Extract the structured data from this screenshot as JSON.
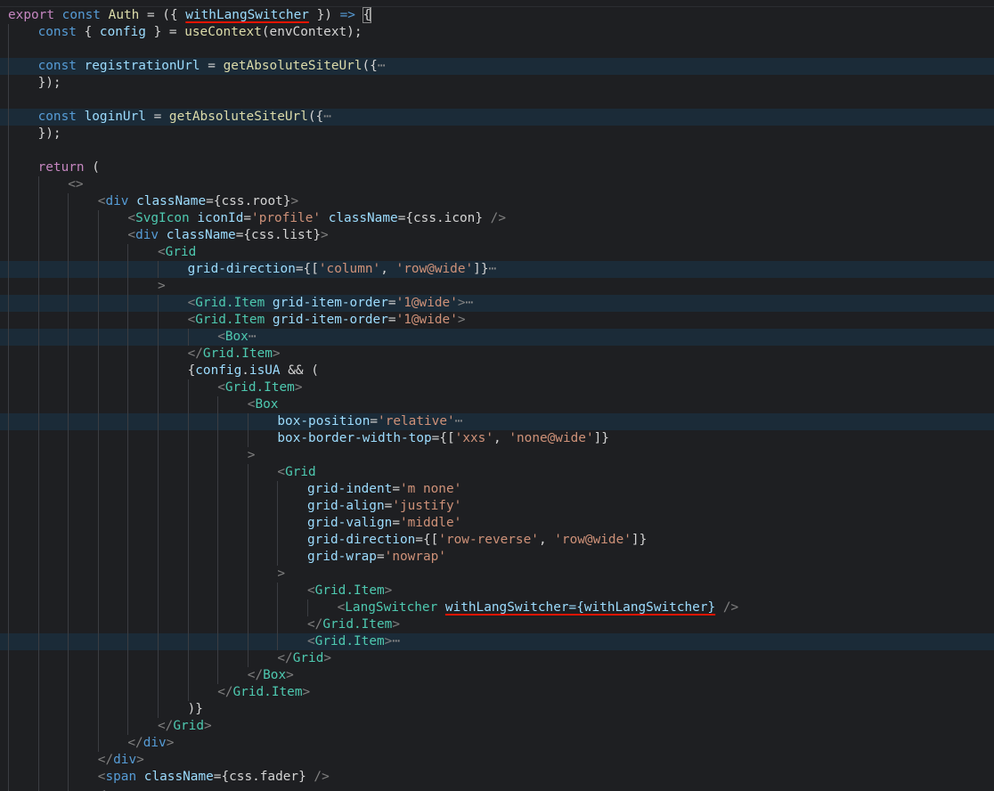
{
  "editor": {
    "language": "tsx",
    "theme_colors": {
      "background": "#1e1f22",
      "line_highlight": "#1b2b38",
      "indent_guide": "#3b3d42",
      "keyword": "#c586c0",
      "storage": "#569cd6",
      "tag": "#4ec9b0",
      "attribute": "#9cdcfe",
      "function": "#dcdcaa",
      "string": "#ce9178",
      "punctuation": "#808080",
      "error_underline": "#e51400"
    },
    "lines": [
      {
        "indent": 0,
        "hl": false,
        "tokens": [
          [
            "export",
            "kw"
          ],
          [
            " ",
            "pl"
          ],
          [
            "const",
            "st"
          ],
          [
            " ",
            "pl"
          ],
          [
            "Auth",
            "ty"
          ],
          [
            " = ({ ",
            "pl"
          ],
          [
            "withLangSwitcher",
            "id err"
          ],
          [
            " }) ",
            "pl"
          ],
          [
            "=>",
            "st"
          ],
          [
            " ",
            "pl"
          ],
          [
            "{",
            "pl mbr"
          ]
        ]
      },
      {
        "indent": 1,
        "hl": false,
        "tokens": [
          [
            "const",
            "st"
          ],
          [
            " { ",
            "pl"
          ],
          [
            "config",
            "id"
          ],
          [
            " } = ",
            "pl"
          ],
          [
            "useContext",
            "fn"
          ],
          [
            "(envContext);",
            "pl"
          ]
        ]
      },
      {
        "indent": 1,
        "hl": false,
        "tokens": []
      },
      {
        "indent": 1,
        "hl": true,
        "tokens": [
          [
            "const",
            "st"
          ],
          [
            " ",
            "pl"
          ],
          [
            "registrationUrl",
            "id"
          ],
          [
            " = ",
            "pl"
          ],
          [
            "getAbsoluteSiteUrl",
            "fn"
          ],
          [
            "({",
            "pl"
          ],
          [
            "⋯",
            "ell"
          ]
        ]
      },
      {
        "indent": 1,
        "hl": false,
        "tokens": [
          [
            "});",
            "pl"
          ]
        ]
      },
      {
        "indent": 1,
        "hl": false,
        "tokens": []
      },
      {
        "indent": 1,
        "hl": true,
        "tokens": [
          [
            "const",
            "st"
          ],
          [
            " ",
            "pl"
          ],
          [
            "loginUrl",
            "id"
          ],
          [
            " = ",
            "pl"
          ],
          [
            "getAbsoluteSiteUrl",
            "fn"
          ],
          [
            "({",
            "pl"
          ],
          [
            "⋯",
            "ell"
          ]
        ]
      },
      {
        "indent": 1,
        "hl": false,
        "tokens": [
          [
            "});",
            "pl"
          ]
        ]
      },
      {
        "indent": 1,
        "hl": false,
        "tokens": []
      },
      {
        "indent": 1,
        "hl": false,
        "tokens": [
          [
            "return",
            "kw"
          ],
          [
            " (",
            "pl"
          ]
        ]
      },
      {
        "indent": 2,
        "hl": false,
        "tokens": [
          [
            "<>",
            "br"
          ]
        ]
      },
      {
        "indent": 3,
        "hl": false,
        "tokens": [
          [
            "<",
            "br"
          ],
          [
            "div",
            "st"
          ],
          [
            " ",
            "pl"
          ],
          [
            "className",
            "at"
          ],
          [
            "=",
            "pl"
          ],
          [
            "{css.root}",
            "pl"
          ],
          [
            ">",
            "br"
          ]
        ]
      },
      {
        "indent": 4,
        "hl": false,
        "tokens": [
          [
            "<",
            "br"
          ],
          [
            "SvgIcon",
            "tg"
          ],
          [
            " ",
            "pl"
          ],
          [
            "iconId",
            "at"
          ],
          [
            "=",
            "pl"
          ],
          [
            "'profile'",
            "str"
          ],
          [
            " ",
            "pl"
          ],
          [
            "className",
            "at"
          ],
          [
            "=",
            "pl"
          ],
          [
            "{css.icon}",
            "pl"
          ],
          [
            " />",
            "br"
          ]
        ]
      },
      {
        "indent": 4,
        "hl": false,
        "tokens": [
          [
            "<",
            "br"
          ],
          [
            "div",
            "st"
          ],
          [
            " ",
            "pl"
          ],
          [
            "className",
            "at"
          ],
          [
            "=",
            "pl"
          ],
          [
            "{css.list}",
            "pl"
          ],
          [
            ">",
            "br"
          ]
        ]
      },
      {
        "indent": 5,
        "hl": false,
        "tokens": [
          [
            "<",
            "br"
          ],
          [
            "Grid",
            "tg"
          ]
        ]
      },
      {
        "indent": 6,
        "hl": true,
        "tokens": [
          [
            "grid-direction",
            "at"
          ],
          [
            "={[",
            "pl"
          ],
          [
            "'column'",
            "str"
          ],
          [
            ", ",
            "pl"
          ],
          [
            "'row@wide'",
            "str"
          ],
          [
            "]}",
            "pl"
          ],
          [
            "⋯",
            "ell"
          ]
        ]
      },
      {
        "indent": 5,
        "hl": false,
        "tokens": [
          [
            ">",
            "br"
          ]
        ]
      },
      {
        "indent": 6,
        "hl": true,
        "tokens": [
          [
            "<",
            "br"
          ],
          [
            "Grid.Item",
            "tg"
          ],
          [
            " ",
            "pl"
          ],
          [
            "grid-item-order",
            "at"
          ],
          [
            "=",
            "pl"
          ],
          [
            "'1@wide'",
            "str"
          ],
          [
            ">",
            "br"
          ],
          [
            "⋯",
            "ell"
          ]
        ]
      },
      {
        "indent": 6,
        "hl": false,
        "tokens": [
          [
            "<",
            "br"
          ],
          [
            "Grid.Item",
            "tg"
          ],
          [
            " ",
            "pl"
          ],
          [
            "grid-item-order",
            "at"
          ],
          [
            "=",
            "pl"
          ],
          [
            "'1@wide'",
            "str"
          ],
          [
            ">",
            "br"
          ]
        ]
      },
      {
        "indent": 7,
        "hl": true,
        "tokens": [
          [
            "<",
            "br"
          ],
          [
            "Box",
            "tg"
          ],
          [
            "⋯",
            "ell"
          ]
        ]
      },
      {
        "indent": 6,
        "hl": false,
        "tokens": [
          [
            "</",
            "br"
          ],
          [
            "Grid.Item",
            "tg"
          ],
          [
            ">",
            "br"
          ]
        ]
      },
      {
        "indent": 6,
        "hl": false,
        "tokens": [
          [
            "{",
            "pl"
          ],
          [
            "config",
            "id"
          ],
          [
            ".",
            "pl"
          ],
          [
            "isUA",
            "id"
          ],
          [
            " && (",
            "pl"
          ]
        ]
      },
      {
        "indent": 7,
        "hl": false,
        "tokens": [
          [
            "<",
            "br"
          ],
          [
            "Grid.Item",
            "tg"
          ],
          [
            ">",
            "br"
          ]
        ]
      },
      {
        "indent": 8,
        "hl": false,
        "tokens": [
          [
            "<",
            "br"
          ],
          [
            "Box",
            "tg"
          ]
        ]
      },
      {
        "indent": 9,
        "hl": true,
        "tokens": [
          [
            "box-position",
            "at"
          ],
          [
            "=",
            "pl"
          ],
          [
            "'relative'",
            "str"
          ],
          [
            "⋯",
            "ell"
          ]
        ]
      },
      {
        "indent": 9,
        "hl": false,
        "tokens": [
          [
            "box-border-width-top",
            "at"
          ],
          [
            "={[",
            "pl"
          ],
          [
            "'xxs'",
            "str"
          ],
          [
            ", ",
            "pl"
          ],
          [
            "'none@wide'",
            "str"
          ],
          [
            "]}",
            "pl"
          ]
        ]
      },
      {
        "indent": 8,
        "hl": false,
        "tokens": [
          [
            ">",
            "br"
          ]
        ]
      },
      {
        "indent": 9,
        "hl": false,
        "tokens": [
          [
            "<",
            "br"
          ],
          [
            "Grid",
            "tg"
          ]
        ]
      },
      {
        "indent": 10,
        "hl": false,
        "tokens": [
          [
            "grid-indent",
            "at"
          ],
          [
            "=",
            "pl"
          ],
          [
            "'m none'",
            "str"
          ]
        ]
      },
      {
        "indent": 10,
        "hl": false,
        "tokens": [
          [
            "grid-align",
            "at"
          ],
          [
            "=",
            "pl"
          ],
          [
            "'justify'",
            "str"
          ]
        ]
      },
      {
        "indent": 10,
        "hl": false,
        "tokens": [
          [
            "grid-valign",
            "at"
          ],
          [
            "=",
            "pl"
          ],
          [
            "'middle'",
            "str"
          ]
        ]
      },
      {
        "indent": 10,
        "hl": false,
        "tokens": [
          [
            "grid-direction",
            "at"
          ],
          [
            "={[",
            "pl"
          ],
          [
            "'row-reverse'",
            "str"
          ],
          [
            ", ",
            "pl"
          ],
          [
            "'row@wide'",
            "str"
          ],
          [
            "]}",
            "pl"
          ]
        ]
      },
      {
        "indent": 10,
        "hl": false,
        "tokens": [
          [
            "grid-wrap",
            "at"
          ],
          [
            "=",
            "pl"
          ],
          [
            "'nowrap'",
            "str"
          ]
        ]
      },
      {
        "indent": 9,
        "hl": false,
        "tokens": [
          [
            ">",
            "br"
          ]
        ]
      },
      {
        "indent": 10,
        "hl": false,
        "tokens": [
          [
            "<",
            "br"
          ],
          [
            "Grid.Item",
            "tg"
          ],
          [
            ">",
            "br"
          ]
        ]
      },
      {
        "indent": 11,
        "hl": false,
        "tokens": [
          [
            "<",
            "br"
          ],
          [
            "LangSwitcher",
            "tg"
          ],
          [
            " ",
            "pl"
          ],
          [
            "withLangSwitcher={withLangSwitcher}",
            "at err"
          ],
          [
            " />",
            "br"
          ]
        ]
      },
      {
        "indent": 10,
        "hl": false,
        "tokens": [
          [
            "</",
            "br"
          ],
          [
            "Grid.Item",
            "tg"
          ],
          [
            ">",
            "br"
          ]
        ]
      },
      {
        "indent": 10,
        "hl": true,
        "tokens": [
          [
            "<",
            "br"
          ],
          [
            "Grid.Item",
            "tg"
          ],
          [
            ">",
            "br"
          ],
          [
            "⋯",
            "ell"
          ]
        ]
      },
      {
        "indent": 9,
        "hl": false,
        "tokens": [
          [
            "</",
            "br"
          ],
          [
            "Grid",
            "tg"
          ],
          [
            ">",
            "br"
          ]
        ]
      },
      {
        "indent": 8,
        "hl": false,
        "tokens": [
          [
            "</",
            "br"
          ],
          [
            "Box",
            "tg"
          ],
          [
            ">",
            "br"
          ]
        ]
      },
      {
        "indent": 7,
        "hl": false,
        "tokens": [
          [
            "</",
            "br"
          ],
          [
            "Grid.Item",
            "tg"
          ],
          [
            ">",
            "br"
          ]
        ]
      },
      {
        "indent": 6,
        "hl": false,
        "tokens": [
          [
            ")}",
            "pl"
          ]
        ]
      },
      {
        "indent": 5,
        "hl": false,
        "tokens": [
          [
            "</",
            "br"
          ],
          [
            "Grid",
            "tg"
          ],
          [
            ">",
            "br"
          ]
        ]
      },
      {
        "indent": 4,
        "hl": false,
        "tokens": [
          [
            "</",
            "br"
          ],
          [
            "div",
            "st"
          ],
          [
            ">",
            "br"
          ]
        ]
      },
      {
        "indent": 3,
        "hl": false,
        "tokens": [
          [
            "</",
            "br"
          ],
          [
            "div",
            "st"
          ],
          [
            ">",
            "br"
          ]
        ]
      },
      {
        "indent": 3,
        "hl": false,
        "tokens": [
          [
            "<",
            "br"
          ],
          [
            "span",
            "st"
          ],
          [
            " ",
            "pl"
          ],
          [
            "className",
            "at"
          ],
          [
            "=",
            "pl"
          ],
          [
            "{css.fader}",
            "pl"
          ],
          [
            " />",
            "br"
          ]
        ]
      },
      {
        "indent": 3,
        "hl": false,
        "tokens": [
          [
            "<",
            "br"
          ]
        ]
      }
    ]
  }
}
